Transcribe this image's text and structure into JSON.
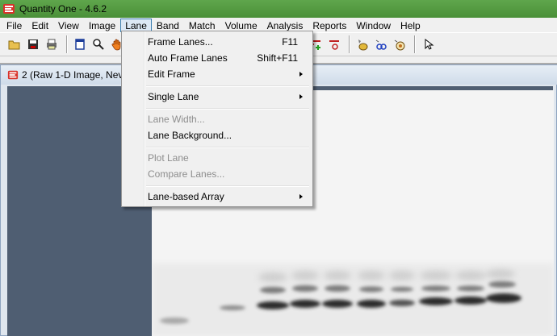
{
  "window": {
    "title": "Quantity One - 4.6.2"
  },
  "menubar": {
    "items": [
      {
        "label": "File"
      },
      {
        "label": "Edit"
      },
      {
        "label": "View"
      },
      {
        "label": "Image"
      },
      {
        "label": "Lane"
      },
      {
        "label": "Band"
      },
      {
        "label": "Match"
      },
      {
        "label": "Volume"
      },
      {
        "label": "Analysis"
      },
      {
        "label": "Reports"
      },
      {
        "label": "Window"
      },
      {
        "label": "Help"
      }
    ],
    "active": "Lane"
  },
  "lane_menu": {
    "items": [
      {
        "label": "Frame Lanes...",
        "shortcut": "F11",
        "enabled": true
      },
      {
        "label": "Auto Frame Lanes",
        "shortcut": "Shift+F11",
        "enabled": true
      },
      {
        "label": "Edit Frame",
        "submenu": true,
        "enabled": true
      },
      {
        "label": "Single Lane",
        "submenu": true,
        "enabled": true
      },
      {
        "label": "Lane Width...",
        "enabled": false
      },
      {
        "label": "Lane Background...",
        "enabled": true
      },
      {
        "label": "Plot Lane",
        "enabled": false
      },
      {
        "label": "Compare Lanes...",
        "enabled": false
      },
      {
        "label": "Lane-based Array",
        "submenu": true,
        "enabled": true
      }
    ]
  },
  "document": {
    "title": "2 (Raw 1-D Image, Nev"
  },
  "icons": {
    "app": "quantity-one-logo-icon",
    "toolbar": [
      "open-folder-icon",
      "save-icon",
      "print-icon",
      "window-icon",
      "zoom-icon",
      "hand-icon",
      "lane-frame-icon",
      "band-add-icon",
      "band-remove-icon",
      "band-detect-icon",
      "analysis-icon",
      "match-icon",
      "volume-icon",
      "pointer-icon"
    ]
  },
  "colors": {
    "titlebar": "#4f9a3e",
    "menu_highlight": "#dce8f5",
    "mdi_background": "#4f5e72"
  }
}
